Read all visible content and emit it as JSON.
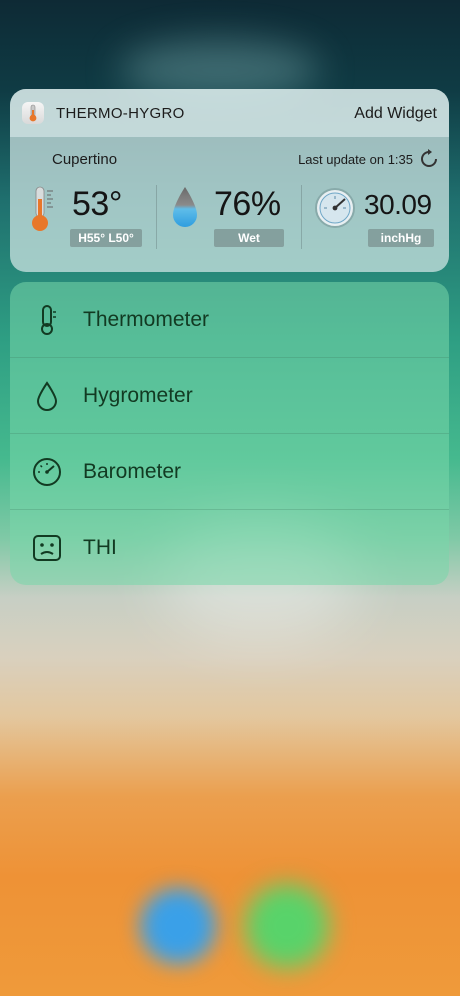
{
  "widget": {
    "app_name": "THERMO-HYGRO",
    "add_widget_label": "Add Widget",
    "city": "Cupertino",
    "last_update": "Last update on 1:35",
    "temperature": {
      "value": "53°",
      "range": "H55° L50°"
    },
    "humidity": {
      "value": "76%",
      "status": "Wet"
    },
    "pressure": {
      "value": "30.09",
      "unit": "inchHg"
    }
  },
  "menu": {
    "items": [
      {
        "label": "Thermometer",
        "icon": "thermometer-icon"
      },
      {
        "label": "Hygrometer",
        "icon": "droplet-icon"
      },
      {
        "label": "Barometer",
        "icon": "gauge-icon"
      },
      {
        "label": "THI",
        "icon": "face-icon"
      }
    ]
  },
  "colors": {
    "menu_text": "#123a22",
    "thermo_orange": "#e8772a",
    "drop_blue": "#4ab1e6"
  }
}
